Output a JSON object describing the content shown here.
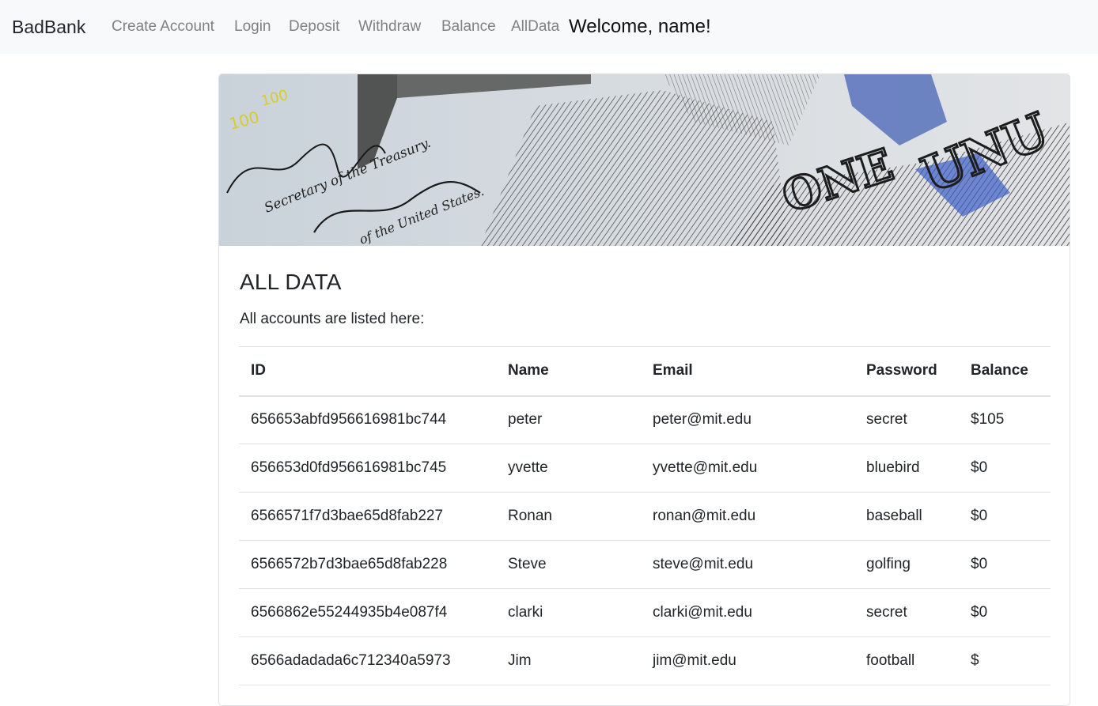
{
  "navbar": {
    "brand": "BadBank",
    "links": [
      "Create Account",
      "Login",
      "Deposit",
      "Withdraw",
      "Balance",
      "AllData"
    ],
    "welcome": "Welcome, name!"
  },
  "banner": {
    "lines": [
      "Secretary of the Treasury.",
      "of the United States."
    ],
    "digits": "100"
  },
  "card": {
    "title": "ALL DATA",
    "text": "All accounts are listed here:"
  },
  "table": {
    "headers": [
      "ID",
      "Name",
      "Email",
      "Password",
      "Balance"
    ],
    "rows": [
      [
        "656653abfd956616981bc744",
        "peter",
        "peter@mit.edu",
        "secret",
        "$105"
      ],
      [
        "656653d0fd956616981bc745",
        "yvette",
        "yvette@mit.edu",
        "bluebird",
        "$0"
      ],
      [
        "6566571f7d3bae65d8fab227",
        "Ronan",
        "ronan@mit.edu",
        "baseball",
        "$0"
      ],
      [
        "6566572b7d3bae65d8fab228",
        "Steve",
        "steve@mit.edu",
        "golfing",
        "$0"
      ],
      [
        "6566862e55244935b4e087f4",
        "clarki",
        "clarki@mit.edu",
        "secret",
        "$0"
      ],
      [
        "6566adadada6c712340a5973",
        "Jim",
        "jim@mit.edu",
        "football",
        "$"
      ]
    ]
  }
}
